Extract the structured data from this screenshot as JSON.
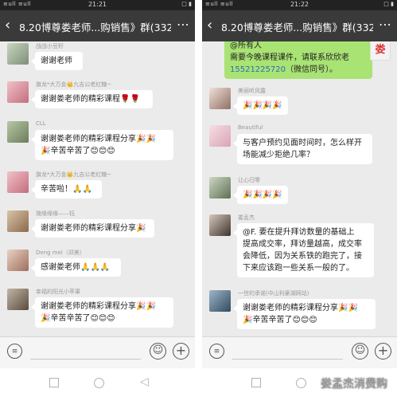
{
  "left": {
    "status": {
      "signal": "≡ull ≡ull",
      "time": "21:21",
      "indicators": "□ ▮"
    },
    "title": "8.20博尊娄老师...购销售》群(332)",
    "messages": [
      {
        "sender": "战战小豆籽",
        "text": "谢谢老师"
      },
      {
        "sender": "旗龙*大万金👑九吉公老红糖~",
        "text": "谢谢娄老师的精彩课程🌹🌹"
      },
      {
        "sender": "CLL",
        "text": "谢谢娄老师的精彩课程分享🎉🎉",
        "text2": "🎉辛苦辛苦了😊😊😊"
      },
      {
        "sender": "旗龙*大万金👑九吉公老红糖~",
        "text": "辛苦啦！🙏🙏"
      },
      {
        "sender": "琉缘缘缘——钰",
        "text": "谢谢娄老师的精彩课程分享🎉"
      },
      {
        "sender": "Deng mei（邓美）",
        "text": "感谢娄老师🙏🙏🙏"
      },
      {
        "sender": "幸福的阳光小苹果",
        "text": "谢谢娄老师的精彩课程分享🎉🎉",
        "text2": "🎉辛苦辛苦了😊😊😊"
      }
    ]
  },
  "right": {
    "status": {
      "signal": "≡ull ≡ull",
      "time": "21:22",
      "indicators": "□ ▮"
    },
    "title": "8.20博尊娄老师...购销售》群(332)",
    "top_green": {
      "line1": "@所有人",
      "line2": "需要今晚课程课件，请联系欣欣老",
      "line3_phone": "15521225720",
      "line3_rest": "（微信同号）。"
    },
    "messages": [
      {
        "sender": "美丽听风露",
        "text": "🎉🎉🎉🎉"
      },
      {
        "sender": "Beautiful",
        "text": "与客户预约见面时间时，怎么样开",
        "text2": "场能减少拒绝几率？"
      },
      {
        "sender": "让心归零",
        "text": "🎉🎉🎉🎉"
      },
      {
        "sender": "娄孟杰",
        "text": "@F. 要在提升拜访数量的基础上",
        "text2": "提高成交率，拜访量越高，成交率",
        "text3": "会降低，因为关系铁的跑完了，接",
        "text4": "下来应该跑一些关系一般的了。"
      },
      {
        "sender": "一世的承诺(中山利豪湖网站)",
        "text": "谢谢娄老师的精彩课程分享🎉🎉",
        "text2": "🎉辛苦辛苦了😊😊😊"
      }
    ],
    "watermark": "娄孟杰消费购"
  },
  "colors": {
    "navbar": "#3a3a3a",
    "chat_bg": "#ebebeb",
    "green_bubble": "#a8e373",
    "phone_link": "#2f6fb5"
  }
}
